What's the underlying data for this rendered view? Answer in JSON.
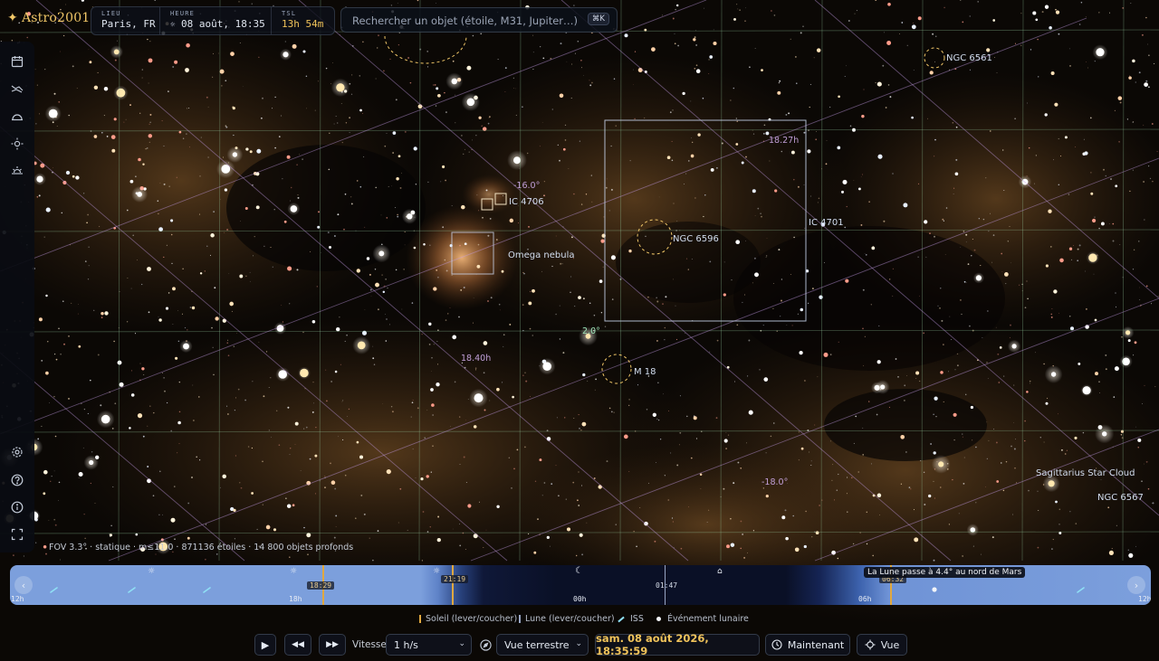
{
  "app": {
    "name": "Astro2001"
  },
  "info": {
    "lieu_label": "LIEU",
    "lieu_value": "Paris, FR",
    "heure_label": "HEURE",
    "heure_value": "08 août, 18:35",
    "tsl_label": "TSL",
    "tsl_value": "13h 54m"
  },
  "search": {
    "placeholder": "Rechercher un objet (étoile, M31, Jupiter…)",
    "shortcut": "⌘K"
  },
  "sidebar": {
    "top": [
      "calendar-icon",
      "constellation-icon",
      "horizon-icon",
      "sun-icon",
      "sunrise-icon"
    ],
    "bottom": [
      "settings-icon",
      "help-icon",
      "info-icon",
      "fullscreen-icon"
    ]
  },
  "sky": {
    "objects": [
      {
        "id": "ngc6561",
        "label": "NGC 6561"
      },
      {
        "id": "ic4706",
        "label": "IC 4706"
      },
      {
        "id": "omega",
        "label": "Omega nebula"
      },
      {
        "id": "ngc6596",
        "label": "NGC 6596"
      },
      {
        "id": "ic4701",
        "label": "IC 4701"
      },
      {
        "id": "m18",
        "label": "M 18"
      },
      {
        "id": "sgr",
        "label": "Sagittarius Star Cloud"
      },
      {
        "id": "ngc6567",
        "label": "NGC 6567"
      }
    ],
    "grid_labels": {
      "dec1": "-16.0°",
      "ra1": "18.27h",
      "ra2": "18.40h",
      "dec2": "-18.0°",
      "fov_mark": "2.0°"
    }
  },
  "status": {
    "text": "FOV 3.3° · statique · m≤11.0 · 871136 étoiles · 14 800 objets profonds"
  },
  "timeline": {
    "ticks": {
      "t12h": "12h",
      "t18h": "18h",
      "t00h": "00h",
      "t06h": "06h",
      "t12h_end": "12h"
    },
    "chips": {
      "sunset": "18:29",
      "moonset": "21:19",
      "moonrise": "01:47",
      "sunrise": "06:32"
    },
    "tooltip": "La Lune passe à 4.4° au nord de Mars"
  },
  "legend": {
    "sun": "Soleil (lever/coucher)",
    "moon": "Lune (lever/coucher)",
    "iss": "ISS",
    "lunar": "Événement lunaire"
  },
  "controls": {
    "vitesse_label": "Vitesse",
    "speed_value": "1 h/s",
    "view_mode": "Vue terrestre",
    "datetime": "sam. 08 août 2026, 18:35:59",
    "now_label": "Maintenant",
    "view_label": "Vue"
  },
  "colors": {
    "accent": "#f0c35a",
    "timeline_day": "#7c9fdc",
    "timeline_night": "#0a1026",
    "grid_purple": "#b98fd6",
    "grid_green": "#9fd8a8"
  }
}
